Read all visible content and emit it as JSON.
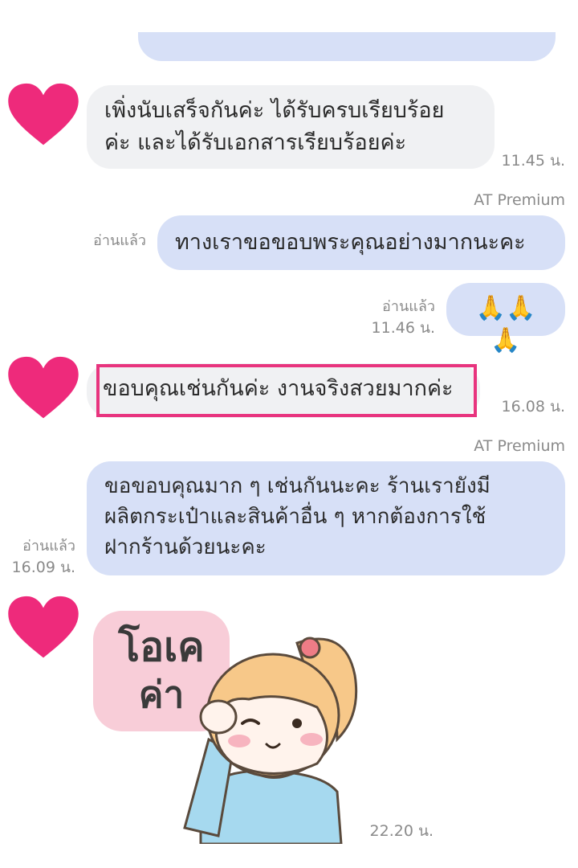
{
  "colors": {
    "heart": "#ee2a7b",
    "incoming_bubble": "#f0f1f3",
    "outgoing_bubble": "#d7e0f7",
    "highlight_box": "#e8347e"
  },
  "messages": [
    {
      "lines": [
        "เพิ่งนับเสร็จกันค่ะ ได้รับครบเรียบร้อย",
        "ค่ะ และได้รับเอกสารเรียบร้อยค่ะ"
      ],
      "time": "11.45 น."
    },
    {
      "sender": "AT Premium",
      "read": "อ่านแล้ว",
      "lines": [
        "ทางเราขอขอบพระคุณอย่างมากนะคะ"
      ]
    },
    {
      "read": "อ่านแล้ว",
      "time": "11.46 น.",
      "emoji": "🙏🙏🙏"
    },
    {
      "lines": [
        "ขอบคุณเช่นกันค่ะ งานจริงสวยมากค่ะ"
      ],
      "time": "16.08 น."
    },
    {
      "sender": "AT Premium",
      "read": "อ่านแล้ว",
      "time": "16.09 น.",
      "lines": [
        "ขอขอบคุณมาก ๆ เช่นกันนะคะ ร้านเรายังมี",
        "ผลิตกระเป๋าและสินค้าอื่น ๆ หากต้องการใช้",
        "ฝากร้านด้วยนะคะ"
      ]
    },
    {
      "sticker": {
        "line1": "โอเค",
        "line2": "ค่า"
      },
      "time": "22.20 น."
    }
  ],
  "icons": {
    "avatar": "heart-icon",
    "sticker": "girl-sticker"
  }
}
